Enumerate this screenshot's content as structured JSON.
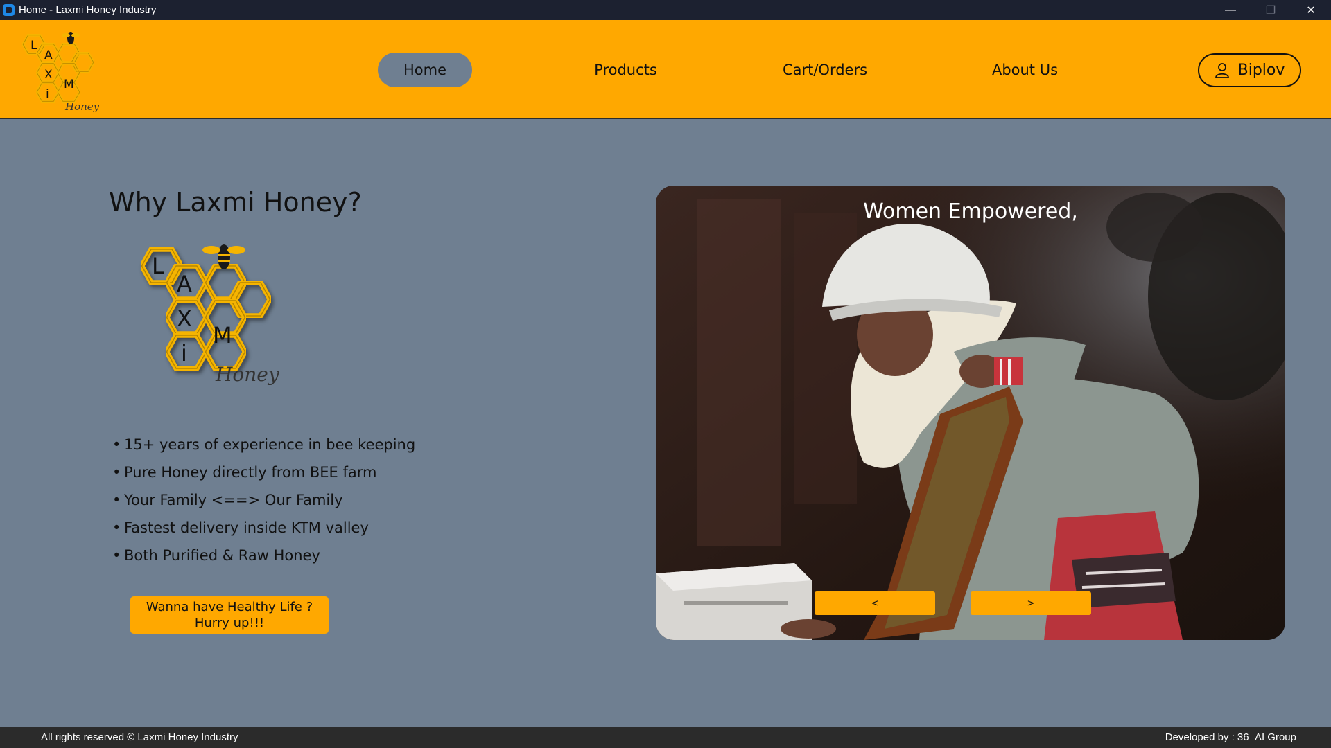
{
  "window": {
    "title": "Home - Laxmi Honey Industry",
    "minimize_icon": "minimize-icon",
    "restore_icon": "restore-icon",
    "close_icon": "close-icon"
  },
  "brand": {
    "logo_letters": [
      "L",
      "A",
      "X",
      "i",
      "M"
    ],
    "logo_script": "Honey",
    "accent_color": "#ffa800",
    "background_color": "#6f7f91"
  },
  "nav": {
    "items": [
      {
        "label": "Home",
        "active": true
      },
      {
        "label": "Products",
        "active": false
      },
      {
        "label": "Cart/Orders",
        "active": false
      },
      {
        "label": "About Us",
        "active": false
      }
    ],
    "user": {
      "label": "Biplov",
      "icon": "user-icon"
    }
  },
  "main": {
    "heading": "Why Laxmi Honey?",
    "features": [
      "15+ years of experience in bee keeping",
      "Pure Honey directly from BEE farm",
      "Your Family <==> Our Family",
      "Fastest delivery inside KTM valley",
      "Both Purified & Raw Honey"
    ],
    "cta": {
      "line1": "Wanna have Healthy Life ?",
      "line2": "Hurry up!!!"
    }
  },
  "slideshow": {
    "caption": "Women Empowered,",
    "prev_label": "<",
    "next_label": ">"
  },
  "footer": {
    "copyright": "All rights reserved © Laxmi Honey Industry",
    "developer": "Developed by : 36_AI Group"
  }
}
